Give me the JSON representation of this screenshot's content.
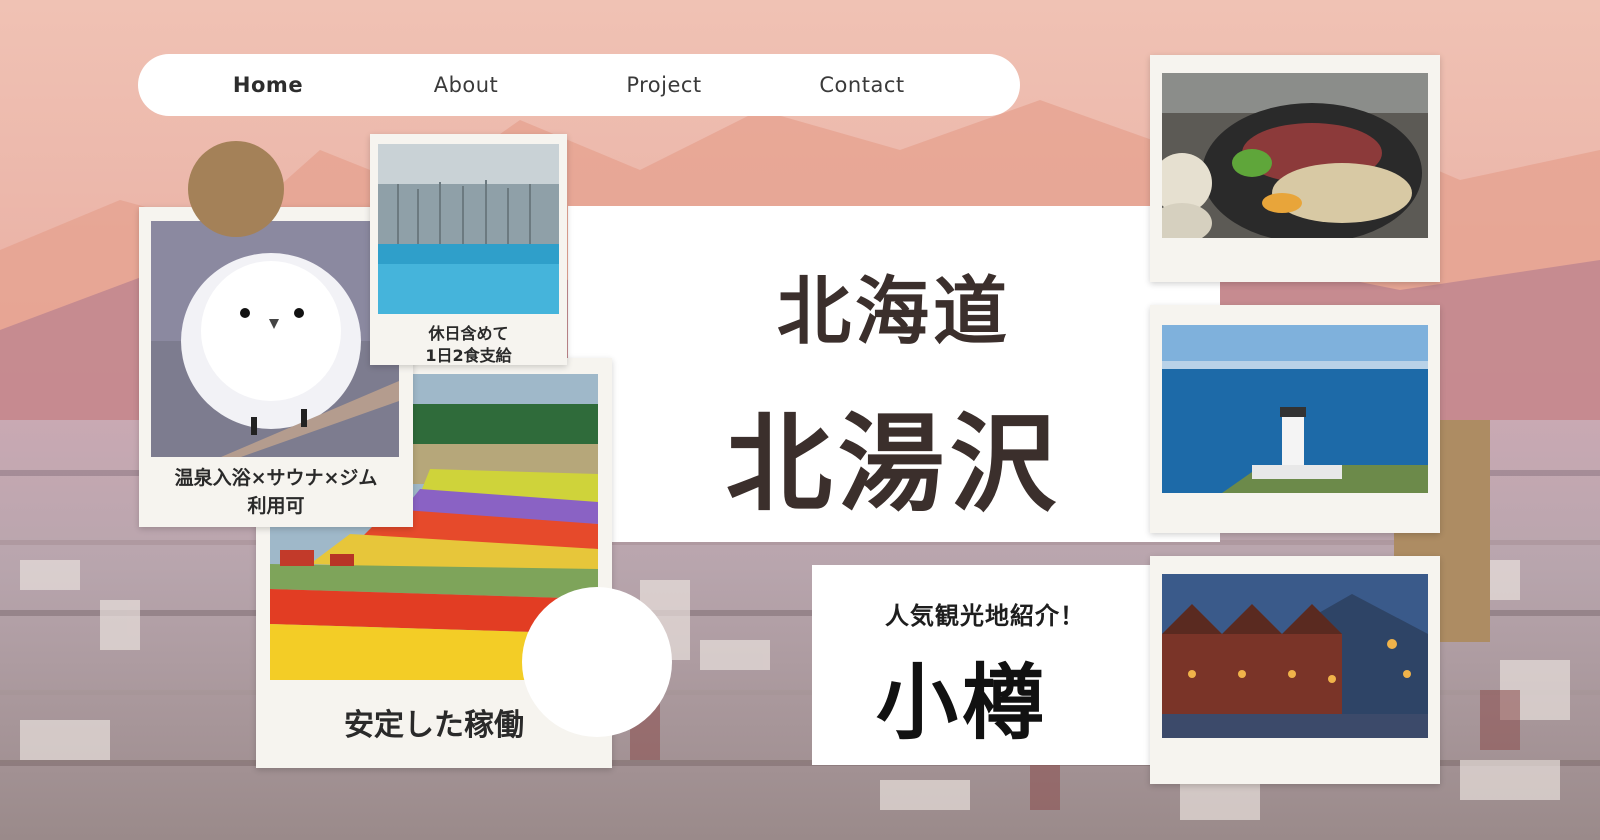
{
  "nav": {
    "items": [
      {
        "label": "Home",
        "active": true
      },
      {
        "label": "About",
        "active": false
      },
      {
        "label": "Project",
        "active": false
      },
      {
        "label": "Contact",
        "active": false
      }
    ]
  },
  "hero": {
    "line1": "北海道",
    "line2": "北湯沢"
  },
  "feature": {
    "label": "人気観光地紹介！",
    "city": "小樽"
  },
  "cards": {
    "bird_caption_line1": "温泉入浴×サウナ×ジム",
    "bird_caption_line2": "利用可",
    "pond_caption_line1": "休日含めて",
    "pond_caption_line2": "1日2食支給",
    "flower_caption": "安定した稼働"
  },
  "colors": {
    "accent_tan": "#ad8c63",
    "title_text": "#3b2f2c",
    "sky_pink": "#e9b3a3"
  }
}
